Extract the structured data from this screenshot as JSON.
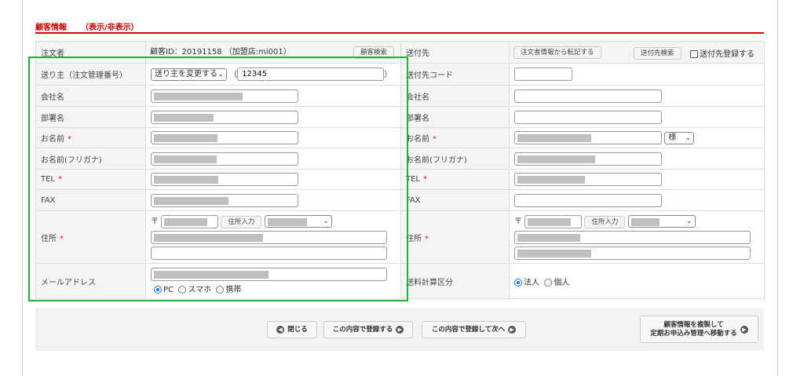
{
  "section": {
    "title": "顧客情報",
    "toggle": "（表示/非表示）"
  },
  "orderer": {
    "header": "注文者",
    "customer_id": "顧客ID：20191158 （加盟店:mi001）",
    "search_button": "顧客検索",
    "sender_label": "送り主（注文管理番号）",
    "sender_select": "送り主を変更する",
    "order_number": "12345",
    "paren_open": "（",
    "paren_close": "）",
    "company": "会社名",
    "department": "部署名",
    "name": "お名前",
    "kana": "お名前(フリガナ)",
    "tel": "TEL",
    "fax": "FAX",
    "address": "住所",
    "postal_mark": "〒",
    "address_button": "住所入力",
    "email": "メールアドレス",
    "device_options": [
      "PC",
      "スマホ",
      "携帯"
    ],
    "device_selected": "PC",
    "required_mark": "*"
  },
  "recipient": {
    "header": "送付先",
    "copy_button": "注文者情報から転記する",
    "search_button": "送付先検索",
    "register_checkbox": "送付先登録する",
    "code": "送付先コード",
    "company": "会社名",
    "department": "部署名",
    "name": "お名前",
    "honorific": "様",
    "kana": "お名前(フリガナ)",
    "tel": "TEL",
    "fax": "FAX",
    "address": "住所",
    "postal_mark": "〒",
    "address_button": "住所入力",
    "shipping_calc": "送料計算区分",
    "shipping_options": [
      "法人",
      "個人"
    ],
    "shipping_selected": "法人",
    "required_mark": "*"
  },
  "footer": {
    "close": "閉じる",
    "register": "この内容で登録する",
    "register_next": "この内容で登録して次へ",
    "copy_line1": "顧客情報を複製して",
    "copy_line2": "定期お申込み管理へ移動する"
  },
  "colors": {
    "accent": "#d40000",
    "highlight": "#1db33b"
  }
}
